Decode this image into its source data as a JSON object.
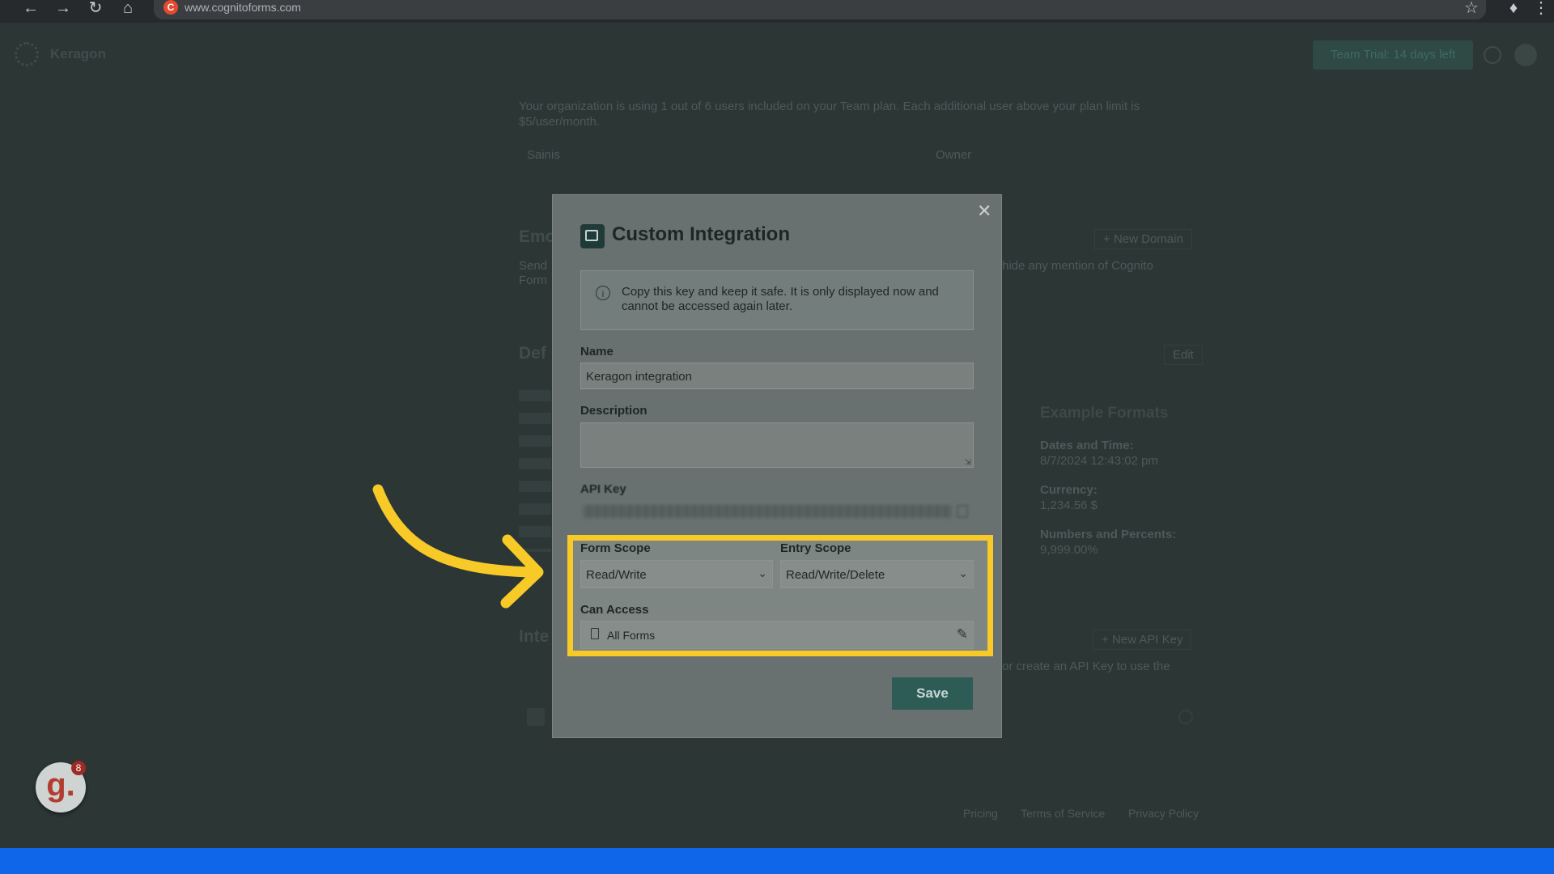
{
  "browser": {
    "url": "www.cognitoforms.com"
  },
  "background": {
    "org_name": "Keragon",
    "trial_button": "Team Trial: 14 days left",
    "users_text": "Your organization is using 1 out of 6 users included on your Team plan. Each additional user above your plan limit is $5/user/month.",
    "user_name": "Sainis",
    "user_role": "Owner",
    "email_heading": "Emo",
    "email_desc": "Send",
    "email_desc2": "Form",
    "hide_mention": "hide any mention of Cognito",
    "new_domain": "New Domain",
    "defaults_heading": "Def",
    "edit": "Edit",
    "example_formats": "Example Formats",
    "dates_time_label": "Dates and Time:",
    "dates_time_value": "8/7/2024 12:43:02 pm",
    "currency_label": "Currency:",
    "currency_value": "1,234.56 $",
    "numbers_label": "Numbers and Percents:",
    "numbers_value": "9,999.00%",
    "integrations_heading": "Inte",
    "new_api_key": "New API Key",
    "integrations_desc": "or create an API Key to use the",
    "footer_links": [
      "Pricing",
      "Terms of Service",
      "Privacy Policy"
    ]
  },
  "modal": {
    "title": "Custom Integration",
    "info": "Copy this key and keep it safe. It is only displayed now and cannot be accessed again later.",
    "name_label": "Name",
    "name_value": "Keragon integration",
    "description_label": "Description",
    "description_value": "",
    "api_key_label": "API Key",
    "form_scope_label": "Form Scope",
    "form_scope_value": "Read/Write",
    "entry_scope_label": "Entry Scope",
    "entry_scope_value": "Read/Write/Delete",
    "can_access_label": "Can Access",
    "can_access_value": "All Forms",
    "save_label": "Save"
  },
  "badge": {
    "letter": "g.",
    "count": "8"
  },
  "colors": {
    "highlight": "#f7ca28",
    "save_button": "#2c5c55",
    "bottom_bar": "#1066e8"
  }
}
